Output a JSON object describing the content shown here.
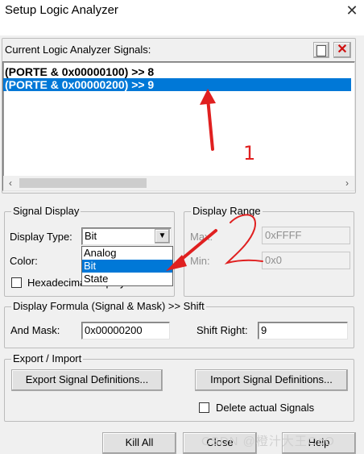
{
  "window": {
    "title": "Setup Logic Analyzer"
  },
  "signals": {
    "label": "Current Logic Analyzer Signals:",
    "items": [
      "(PORTE & 0x00000100) >> 8",
      "(PORTE & 0x00000200) >> 9"
    ],
    "selected_index": 1
  },
  "signal_display": {
    "group_label": "Signal Display",
    "type_label": "Display Type:",
    "type_value": "Bit",
    "type_options": [
      "Analog",
      "Bit",
      "State"
    ],
    "color_label": "Color:",
    "hex_label": "Hexadecimal Display"
  },
  "display_range": {
    "group_label": "Display Range",
    "max_label": "Max:",
    "max_value": "0xFFFF",
    "min_label": "Min:",
    "min_value": "0x0"
  },
  "formula": {
    "group_label": "Display Formula (Signal & Mask) >> Shift",
    "mask_label": "And Mask:",
    "mask_value": "0x00000200",
    "shift_label": "Shift Right:",
    "shift_value": "9"
  },
  "export_import": {
    "group_label": "Export / Import",
    "export_label": "Export Signal Definitions...",
    "import_label": "Import Signal Definitions...",
    "delete_label": "Delete actual Signals"
  },
  "buttons": {
    "kill_all": "Kill All",
    "close": "Close",
    "help": "Help"
  },
  "annotations": {
    "mark1": "1",
    "mark2": "2"
  },
  "watermark": "CSDN @橙汁大王OcO",
  "colors": {
    "selection": "#0078d7",
    "annotation": "#e02020"
  }
}
